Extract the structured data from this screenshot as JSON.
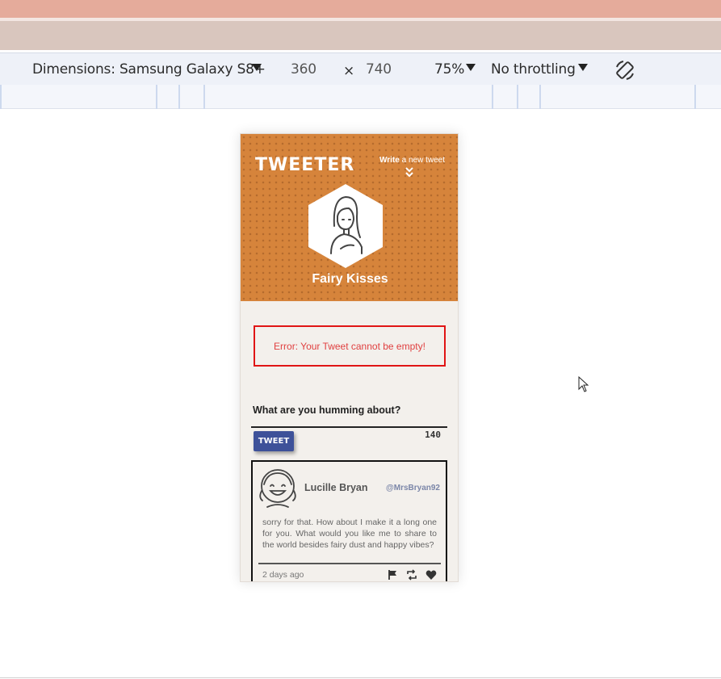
{
  "devtools": {
    "dimensions_label": "Dimensions: Samsung Galaxy S8+",
    "width_value": "360",
    "times_symbol": "×",
    "height_value": "740",
    "zoom": "75%",
    "throttling": "No throttling",
    "rotate_icon": "rotate-device-icon"
  },
  "app": {
    "brand": "TWEETER",
    "write_prefix": "Write",
    "write_suffix": " a new tweet",
    "profile_name": "Fairy Kisses",
    "header_color": "#d6843b"
  },
  "error": {
    "message": "Error: Your Tweet cannot be empty!",
    "border_color": "#e01515"
  },
  "compose": {
    "label": "What are you humming about?",
    "button_label": "TWEET",
    "char_count": "140",
    "button_color": "#3e5199"
  },
  "tweet": {
    "author": "Lucille Bryan",
    "handle": "@MrsBryan92",
    "body": "sorry for that. How about I make it a long one for you. What would you like me to share to the world besides fairy dust and happy vibes?",
    "time": "2 days ago",
    "actions": [
      "flag-icon",
      "retweet-icon",
      "heart-icon"
    ]
  }
}
